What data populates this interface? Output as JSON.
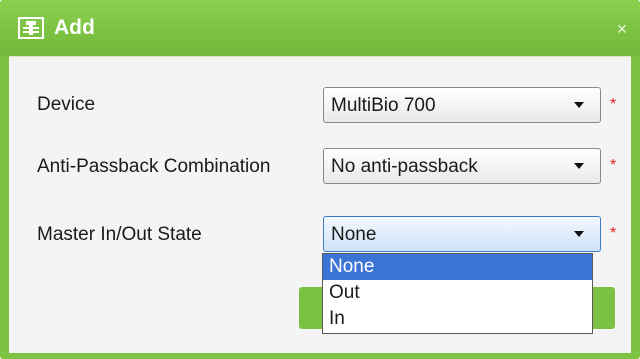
{
  "dialog": {
    "title": "Add",
    "title_icon": "add-form-icon",
    "close_glyph": "×"
  },
  "form": {
    "device": {
      "label": "Device",
      "value": "MultiBio 700",
      "required_mark": "*"
    },
    "anti_passback": {
      "label": "Anti-Passback Combination",
      "value": "No anti-passback",
      "required_mark": "*"
    },
    "master_state": {
      "label": "Master In/Out State",
      "value": "None",
      "required_mark": "*"
    }
  },
  "dropdown": {
    "options": [
      "None",
      "Out",
      "In"
    ],
    "selected": "None"
  },
  "colors": {
    "accent_green": "#7dc243",
    "highlight_blue": "#3c74d6",
    "required_red": "#e02020"
  }
}
